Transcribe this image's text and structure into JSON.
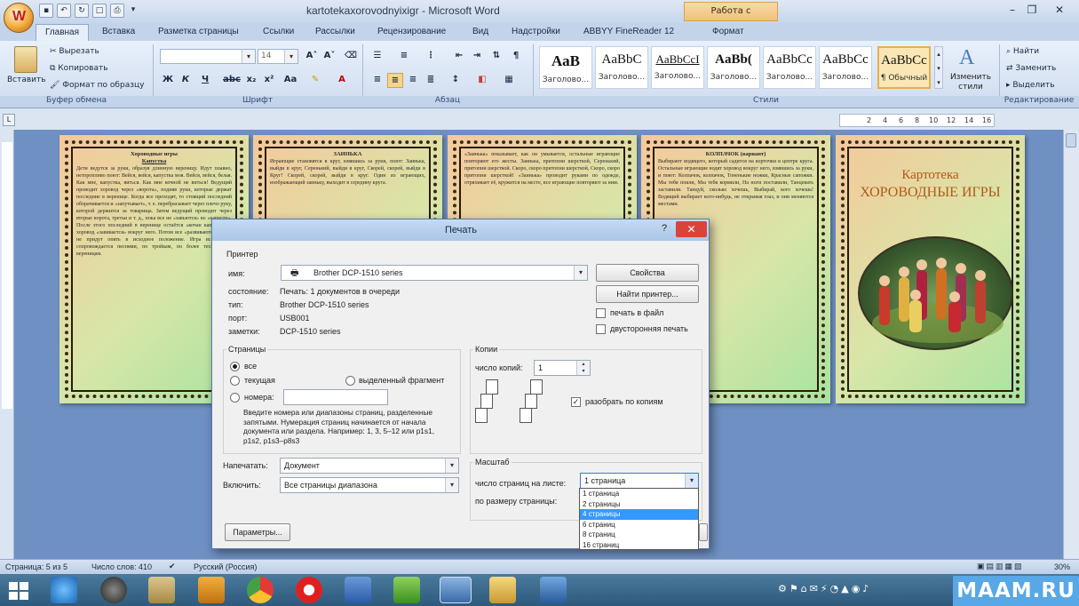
{
  "window": {
    "title": "kartotekaxorovodnyixigr - Microsoft Word",
    "context_tab": "Работа с рисунками",
    "office_button": "W"
  },
  "tabs": [
    "Главная",
    "Вставка",
    "Разметка страницы",
    "Ссылки",
    "Рассылки",
    "Рецензирование",
    "Вид",
    "Надстройки",
    "ABBYY FineReader 12",
    "Формат"
  ],
  "ribbon": {
    "clipboard": {
      "paste": "Вставить",
      "cut": "Вырезать",
      "copy": "Копировать",
      "format_painter": "Формат по образцу",
      "label": "Буфер обмена"
    },
    "font": {
      "font_size": "14",
      "label": "Шрифт"
    },
    "paragraph": {
      "label": "Абзац"
    },
    "styles": {
      "items": [
        {
          "sample": "АаВ",
          "name": "Заголово..."
        },
        {
          "sample": "AaBbC",
          "name": "Заголово..."
        },
        {
          "sample": "AaBbCcI",
          "name": "Заголово..."
        },
        {
          "sample": "AaBb(",
          "name": "Заголово..."
        },
        {
          "sample": "AaBbCc",
          "name": "Заголово..."
        },
        {
          "sample": "AaBbCc",
          "name": "Заголово..."
        },
        {
          "sample": "AaBbCc",
          "name": "¶ Обычный"
        }
      ],
      "change_styles": "Изменить стили",
      "label": "Стили"
    },
    "editing": {
      "find": "Найти",
      "replace": "Заменить",
      "select": "Выделить",
      "label": "Редактирование"
    }
  },
  "ruler": {
    "ticks": [
      "2",
      "4",
      "6",
      "8",
      "10",
      "12",
      "14",
      "16"
    ]
  },
  "pages": [
    {
      "heading": "Хороводные игры",
      "subheading": "Капустка",
      "text": "Дети ведутся за руки, образуя длинную вереницу. Идут плавно, неторопливо поют: Вейся, вейся, капустка моя. Вейся, вейся, белая. Как мне, капустка, виться. Как мне кочной не виться! Ведущий проводит хоровод через «ворота», подняв руки, которые держат последние в веренице. Когда все проходят, то стоящий последний оборачивается и «запутывает», т. е. перебрасывает через плечо руку, которой держится за товарища. Затем ведущий проводит через вторые ворота, третьи и т. д., пока все не «завьются» во «капусту». После этого последний в веренице остаётся «кочан капусты», а хоровод «завивается» вокруг него. Потом все «развиваются», пока не придут опять в исходное положение. Игра все время сопровождается песнями, по тройкам, по более тесным, по вереницам."
    },
    {
      "heading": "ЗАИНЬКА",
      "subheading": "",
      "text": "Играющие становятся в круг, взявшись за руки, поют: Заинька, выйди в круг, Серенький, выйди в круг, Скорей, скорей, выйди в Круг! Скорей, скорей, выйди в круг. Один из играющих, изображающий заиньку, выходит в середину круга."
    },
    {
      "heading": "",
      "subheading": "",
      "text": "«Заинька» показывает, как он умывается, остальные играющие повторяют его жесты. Заинька, притопни шерсткой, Серенький, притопни шерсткой. Скоро, скоро притопни шерсткой, Скоро, скоро притопни шерсткой! «Заинька» проводит руками по одежде, отряхивает её, кружится на месте, все играющие повторяют за ним."
    },
    {
      "heading": "КОЛПАЧОК (вариант)",
      "subheading": "",
      "text": "Выбирают водящего, который садится на корточки в центре круга. Остальные играющие водят хоровод вокруг него, взявшись за руки, и поют: Колпачок, колпачок, Тоненькие ножки, Красные сапожки. Мы тебя поили, Мы тебя кормили, На ноги поставили, Танцевать заставили. Танцуй, сколько хочешь, Выбирай, кого хочешь! Водящий выбирает кого-нибудь, не открывая глаз, и они меняются местами."
    },
    {
      "title": "Картотека",
      "subtitle": "ХОРОВОДНЫЕ ИГРЫ"
    }
  ],
  "dialog": {
    "title": "Печать",
    "help": "?",
    "close": "✕",
    "printer": {
      "section": "Принтер",
      "name_label": "имя:",
      "name_value": "Brother DCP-1510 series",
      "status_label": "состояние:",
      "status_value": "Печать: 1 документов в очереди",
      "type_label": "тип:",
      "type_value": "Brother DCP-1510 series",
      "port_label": "порт:",
      "port_value": "USB001",
      "notes_label": "заметки:",
      "notes_value": "DCP-1510 series",
      "properties_button": "Свойства",
      "find_printer_button": "Найти принтер...",
      "print_to_file": "печать в файл",
      "duplex": "двусторонняя печать"
    },
    "pages": {
      "section": "Страницы",
      "all": "все",
      "current": "текущая",
      "selection": "выделенный фрагмент",
      "numbers": "номера:",
      "hint": "Введите номера или диапазоны страниц, разделенные запятыми. Нумерация страниц начинается от начала документа или раздела. Например: 1, 3, 5–12 или p1s1, p1s2, p1s3–p8s3"
    },
    "copies": {
      "section": "Копии",
      "count_label": "число копий:",
      "count_value": "1",
      "collate": "разобрать по копиям"
    },
    "print_what_label": "Напечатать:",
    "print_what_value": "Документ",
    "include_label": "Включить:",
    "include_value": "Все страницы диапазона",
    "zoom": {
      "section": "Масштаб",
      "pages_per_sheet_label": "число страниц на листе:",
      "pages_per_sheet_value": "1 страница",
      "scale_label": "по размеру страницы:",
      "options": [
        "1 страница",
        "2 страницы",
        "4 страницы",
        "6 страниц",
        "8 страниц",
        "16 страниц"
      ],
      "selected_index": 2
    },
    "options_button": "Параметры..."
  },
  "status": {
    "page": "Страница: 5 из 5",
    "words": "Число слов: 410",
    "language": "Русский (Россия)",
    "zoom": "30%"
  },
  "taskbar": {
    "watermark": "MAAM.RU"
  },
  "colors": {
    "close_red": "#d9443a",
    "selection_blue": "#3399ff",
    "watermark_bg": "#58a7e6"
  }
}
